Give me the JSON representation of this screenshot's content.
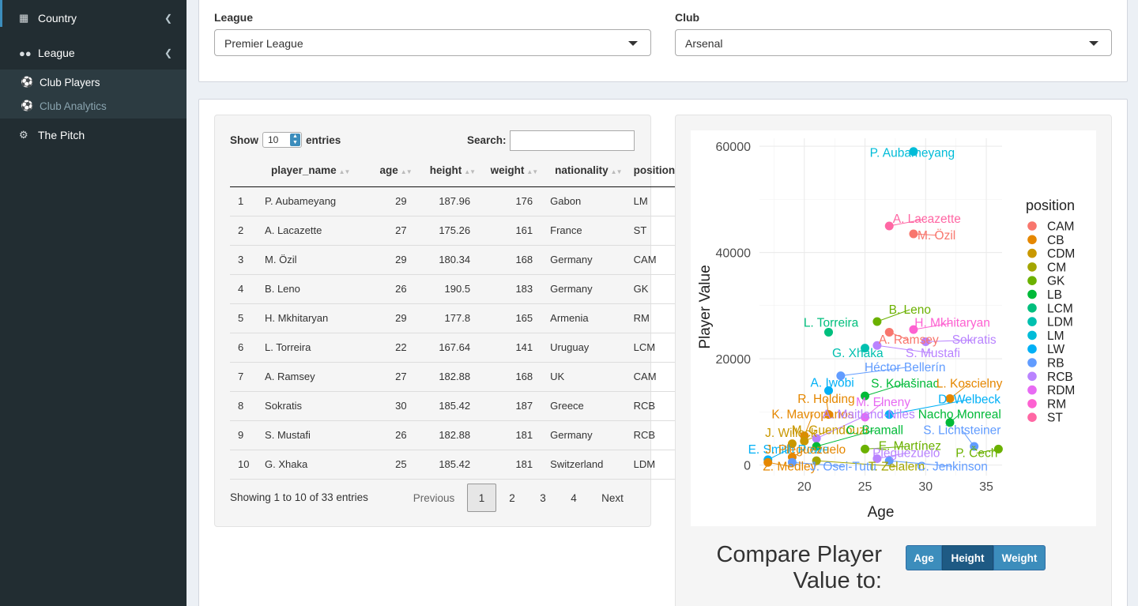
{
  "sidebar": {
    "items": [
      {
        "label": "Country",
        "icon": "map-icon"
      },
      {
        "label": "League",
        "icon": "users-icon"
      },
      {
        "label": "Club Players",
        "icon": "futbol-icon"
      },
      {
        "label": "Club Analytics",
        "icon": "futbol-icon"
      },
      {
        "label": "The Pitch",
        "icon": "cogs-icon"
      }
    ]
  },
  "filters": {
    "league_label": "League",
    "league_value": "Premier League",
    "club_label": "Club",
    "club_value": "Arsenal"
  },
  "table": {
    "show_label": "Show",
    "entries_value": "10",
    "entries_label": "entries",
    "search_label": "Search:",
    "columns": [
      "player_name",
      "age",
      "height",
      "weight",
      "nationality",
      "position"
    ],
    "rows": [
      [
        "1",
        "P. Aubameyang",
        "29",
        "187.96",
        "176",
        "Gabon",
        "LM"
      ],
      [
        "2",
        "A. Lacazette",
        "27",
        "175.26",
        "161",
        "France",
        "ST"
      ],
      [
        "3",
        "M. Özil",
        "29",
        "180.34",
        "168",
        "Germany",
        "CAM"
      ],
      [
        "4",
        "B. Leno",
        "26",
        "190.5",
        "183",
        "Germany",
        "GK"
      ],
      [
        "5",
        "H. Mkhitaryan",
        "29",
        "177.8",
        "165",
        "Armenia",
        "RM"
      ],
      [
        "6",
        "L. Torreira",
        "22",
        "167.64",
        "141",
        "Uruguay",
        "LCM"
      ],
      [
        "7",
        "A. Ramsey",
        "27",
        "182.88",
        "168",
        "UK",
        "CAM"
      ],
      [
        "8",
        "Sokratis",
        "30",
        "185.42",
        "187",
        "Greece",
        "RCB"
      ],
      [
        "9",
        "S. Mustafi",
        "26",
        "182.88",
        "181",
        "Germany",
        "RCB"
      ],
      [
        "10",
        "G. Xhaka",
        "25",
        "185.42",
        "181",
        "Switzerland",
        "LDM"
      ]
    ],
    "info": "Showing 1 to 10 of 33 entries",
    "pagination": {
      "previous": "Previous",
      "pages": [
        "1",
        "2",
        "3",
        "4"
      ],
      "next": "Next"
    }
  },
  "compare": {
    "title": "Compare Player Value to:",
    "buttons": [
      "Age",
      "Height",
      "Weight"
    ],
    "active": "Height"
  },
  "colors": {
    "sidebar": "#222d32",
    "accent": "#3c8dbc",
    "active_button": "#1e5a84"
  },
  "chart_data": {
    "type": "scatter",
    "title": "",
    "xlabel": "Age",
    "ylabel": "Player Value",
    "xlim": [
      16.3,
      36.3
    ],
    "ylim": [
      -2000,
      61500
    ],
    "xticks": [
      20,
      25,
      30,
      35
    ],
    "yticks": [
      0,
      20000,
      40000,
      60000
    ],
    "legend_title": "position",
    "legend": [
      {
        "name": "CAM",
        "color": "#f8766d"
      },
      {
        "name": "CB",
        "color": "#e58700"
      },
      {
        "name": "CDM",
        "color": "#c99800"
      },
      {
        "name": "CM",
        "color": "#a3a500"
      },
      {
        "name": "GK",
        "color": "#6bb100"
      },
      {
        "name": "LB",
        "color": "#00ba38"
      },
      {
        "name": "LCM",
        "color": "#00bf7d"
      },
      {
        "name": "LDM",
        "color": "#00c0af"
      },
      {
        "name": "LM",
        "color": "#00bcd8"
      },
      {
        "name": "LW",
        "color": "#00b0f6"
      },
      {
        "name": "RB",
        "color": "#619cff"
      },
      {
        "name": "RCB",
        "color": "#b983ff"
      },
      {
        "name": "RDM",
        "color": "#e76bf3"
      },
      {
        "name": "RM",
        "color": "#fd61d1"
      },
      {
        "name": "ST",
        "color": "#ff67a4"
      }
    ],
    "points": [
      {
        "label": "P. Aubameyang",
        "pos": "LM",
        "x": 29,
        "y": 59000,
        "lx": 28.9,
        "ly": 58000
      },
      {
        "label": "A. Lacazette",
        "pos": "ST",
        "x": 27,
        "y": 45000,
        "lx": 30.1,
        "ly": 45600
      },
      {
        "label": "M. Özil",
        "pos": "CAM",
        "x": 29,
        "y": 43500,
        "lx": 30.9,
        "ly": 42500
      },
      {
        "label": "B. Leno",
        "pos": "GK",
        "x": 26,
        "y": 27000,
        "lx": 28.7,
        "ly": 28500
      },
      {
        "label": "H. Mkhitaryan",
        "pos": "RM",
        "x": 29,
        "y": 25500,
        "lx": 32.2,
        "ly": 26000
      },
      {
        "label": "L. Torreira",
        "pos": "LCM",
        "x": 22,
        "y": 25000,
        "lx": 22.2,
        "ly": 26000
      },
      {
        "label": "A. Ramsey",
        "pos": "CAM",
        "x": 27,
        "y": 25000,
        "lx": 28.6,
        "ly": 22800
      },
      {
        "label": "Sokratis",
        "pos": "RCB",
        "x": 30,
        "y": 23200,
        "lx": 34.0,
        "ly": 22800
      },
      {
        "label": "S. Mustafi",
        "pos": "RCB",
        "x": 26,
        "y": 22500,
        "lx": 30.6,
        "ly": 20300
      },
      {
        "label": "G. Xhaka",
        "pos": "LDM",
        "x": 25,
        "y": 22000,
        "lx": 24.4,
        "ly": 20300
      },
      {
        "label": "Héctor Bellerín",
        "pos": "RB",
        "x": 23,
        "y": 16800,
        "lx": 28.3,
        "ly": 17600
      },
      {
        "label": "A. Iwobi",
        "pos": "LW",
        "x": 22,
        "y": 14000,
        "lx": 22.3,
        "ly": 14700
      },
      {
        "label": "S. Kolašinac",
        "pos": "LB",
        "x": 25,
        "y": 13000,
        "lx": 28.3,
        "ly": 14600
      },
      {
        "label": "L. Koscielny",
        "pos": "CB",
        "x": 32,
        "y": 12500,
        "lx": 33.6,
        "ly": 14600
      },
      {
        "label": "R. Holding",
        "pos": "CB",
        "x": 22,
        "y": 9500,
        "lx": 21.8,
        "ly": 11700
      },
      {
        "label": "D. Welbeck",
        "pos": "LW",
        "x": 27,
        "y": 9500,
        "lx": 33.6,
        "ly": 11600
      },
      {
        "label": "M. Elneny",
        "pos": "RDM",
        "x": 25,
        "y": 9000,
        "lx": 26.5,
        "ly": 11100
      },
      {
        "label": "K. Mavropanos",
        "pos": "CB",
        "x": 20,
        "y": 5500,
        "lx": 20.7,
        "ly": 8800
      },
      {
        "label": "A. Maitland-Niles",
        "pos": "RCB",
        "x": 21,
        "y": 5000,
        "lx": 25.3,
        "ly": 8800
      },
      {
        "label": "Nacho Monreal",
        "pos": "LB",
        "x": 32,
        "y": 8000,
        "lx": 32.8,
        "ly": 8800
      },
      {
        "label": "J. Willock",
        "pos": "CDM",
        "x": 19,
        "y": 4000,
        "lx": 18.9,
        "ly": 5300
      },
      {
        "label": "M. Guendouzi",
        "pos": "CDM",
        "x": 20,
        "y": 4500,
        "lx": 22.1,
        "ly": 5800
      },
      {
        "label": "C. Bramall",
        "pos": "LB",
        "x": 21,
        "y": 3500,
        "lx": 25.8,
        "ly": 5800
      },
      {
        "label": "S. Lichtsteiner",
        "pos": "RB",
        "x": 34,
        "y": 3500,
        "lx": 33.0,
        "ly": 5800
      },
      {
        "label": "E. Martínez",
        "pos": "GK",
        "x": 25,
        "y": 3000,
        "lx": 28.7,
        "ly": 2800
      },
      {
        "label": "P. Čech",
        "pos": "GK",
        "x": 36,
        "y": 3000,
        "lx": 34.2,
        "ly": 1500
      },
      {
        "label": "E. Smith Rowe",
        "pos": "LW",
        "x": 17,
        "y": 1000,
        "lx": 18.7,
        "ly": 2200
      },
      {
        "label": "J. Pleguezuelo",
        "pos": "CB",
        "x": 19,
        "y": 1500,
        "lx": 20.1,
        "ly": 2200
      },
      {
        "label": "Pleguezuelo",
        "pos": "RCB",
        "x": 26,
        "y": 1200,
        "lx": 28.4,
        "ly": 1500
      },
      {
        "label": "Z. Medley",
        "pos": "CB",
        "x": 17,
        "y": 500,
        "lx": 18.8,
        "ly": -1000
      },
      {
        "label": "J. Osei-Tutu",
        "pos": "RB",
        "x": 19,
        "y": 500,
        "lx": 23.2,
        "ly": -1000
      },
      {
        "label": "T. Zelalem",
        "pos": "CM",
        "x": 21,
        "y": 800,
        "lx": 27.6,
        "ly": -1000
      },
      {
        "label": "C. Jenkinson",
        "pos": "RB",
        "x": 27,
        "y": 800,
        "lx": 32.2,
        "ly": -1000
      }
    ]
  }
}
